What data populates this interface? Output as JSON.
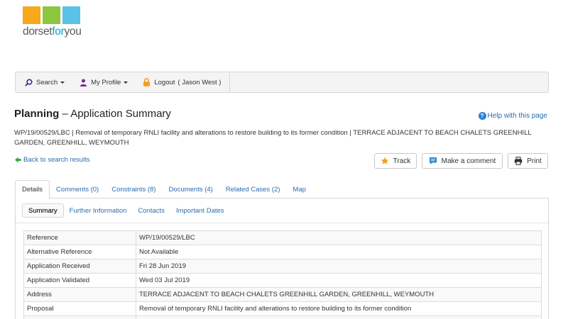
{
  "logo": {
    "text_a": "dorset",
    "text_b": "for",
    "text_c": "you",
    "colors": [
      "#f7a81b",
      "#8dc63f",
      "#5bc2e7"
    ]
  },
  "nav": {
    "search": "Search",
    "profile": "My Profile",
    "logout": "Logout",
    "user": "( Jason West )"
  },
  "header": {
    "title_bold": "Planning",
    "title_rest": " – Application Summary",
    "help": "Help with this page"
  },
  "summary": "WP/19/00529/LBC | Removal of temporary RNLI facility and alterations to restore building to its former condition | TERRACE ADJACENT TO BEACH CHALETS GREENHILL GARDEN, GREENHILL, WEYMOUTH",
  "back": "Back to search results",
  "buttons": {
    "track": "Track",
    "comment": "Make a comment",
    "print": "Print"
  },
  "tabs": [
    "Details",
    "Comments (0)",
    "Constraints (8)",
    "Documents (4)",
    "Related Cases (2)",
    "Map"
  ],
  "subtabs": [
    "Summary",
    "Further Information",
    "Contacts",
    "Important Dates"
  ],
  "details": [
    {
      "key": "Reference",
      "value": "WP/19/00529/LBC"
    },
    {
      "key": "Alternative Reference",
      "value": "Not Available"
    },
    {
      "key": "Application Received",
      "value": "Fri 28 Jun 2019"
    },
    {
      "key": "Application Validated",
      "value": "Wed 03 Jul 2019"
    },
    {
      "key": "Address",
      "value": "TERRACE ADJACENT TO BEACH CHALETS GREENHILL GARDEN, GREENHILL, WEYMOUTH"
    },
    {
      "key": "Proposal",
      "value": "Removal of temporary RNLI facility and alterations to restore building to its former condition"
    },
    {
      "key": "",
      "value": ""
    }
  ],
  "colors": {
    "link": "#2a6cb0",
    "search_icon": "#3d2b8c",
    "profile_icon": "#7a2a8c",
    "lock_icon": "#f0a020",
    "track_star": "#f0a020",
    "comment_icon": "#2a8ad4",
    "back_arrow": "#3aaa35"
  },
  "icons": {
    "search": "search-icon",
    "profile": "user-icon",
    "logout": "lock-icon",
    "help": "question-circle-icon",
    "back": "arrow-left-icon",
    "track": "star-icon",
    "comment": "comment-icon",
    "print": "printer-icon"
  }
}
